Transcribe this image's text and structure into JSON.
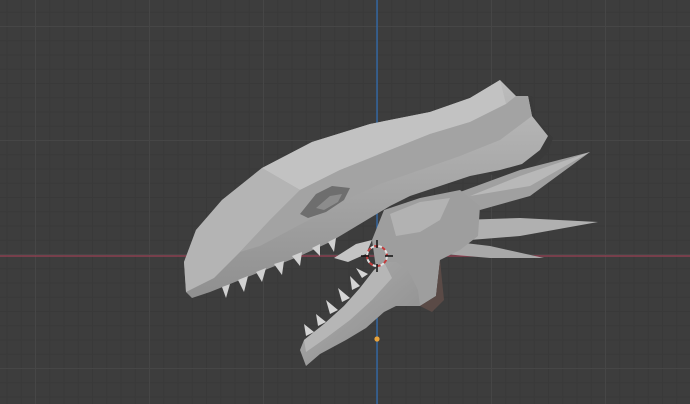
{
  "viewport": {
    "editor": "3D Viewport",
    "object": "dragon-skull-mesh",
    "axis_colors": {
      "x_axis": "#9a4154",
      "y_axis": "#2e6fb7"
    },
    "grid_colors": {
      "background": "#3d3d3d",
      "major_line": "#464646",
      "minor_line": "#393939"
    },
    "mesh_color": "#a6a6a6",
    "origin_dot_color": "#e8a33c",
    "cursor_colors": {
      "ring_primary": "#e0e0e0",
      "ring_secondary": "#c43b3b",
      "crosshair": "#111111"
    }
  }
}
